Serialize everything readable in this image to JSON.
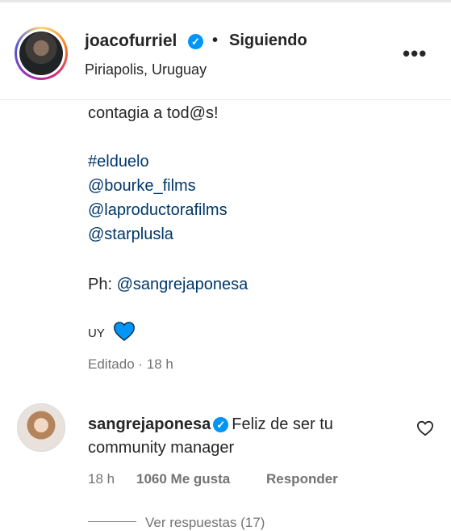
{
  "post": {
    "author": {
      "username": "joacofurriel",
      "verified": true,
      "follow_status": "Siguiendo",
      "location": "Piriapolis, Uruguay"
    },
    "caption": {
      "line_intro": "contagia a tod@s!",
      "hashtag": "#elduelo",
      "mentions": [
        "@bourke_films",
        "@laproductorafilms",
        "@starplusla"
      ],
      "photo_credit_label": "Ph: ",
      "photo_credit_mention": "@sangrejaponesa",
      "sign_off": "UY",
      "heart_color": "#0095f6"
    },
    "meta": "Editado · 18 h"
  },
  "comment": {
    "username": "sangrejaponesa",
    "verified": true,
    "text_line1": "Feliz de ser tu",
    "text_line2": "community manager",
    "time": "18 h",
    "likes": "1060 Me gusta",
    "reply_label": "Responder",
    "view_replies": "Ver respuestas (17)"
  },
  "icons": {
    "more": "more-horizontal-icon",
    "like": "heart-outline-icon",
    "verified": "verified-badge-icon"
  },
  "colors": {
    "link": "#00376b",
    "verified": "#0095f6",
    "muted": "#737373"
  }
}
